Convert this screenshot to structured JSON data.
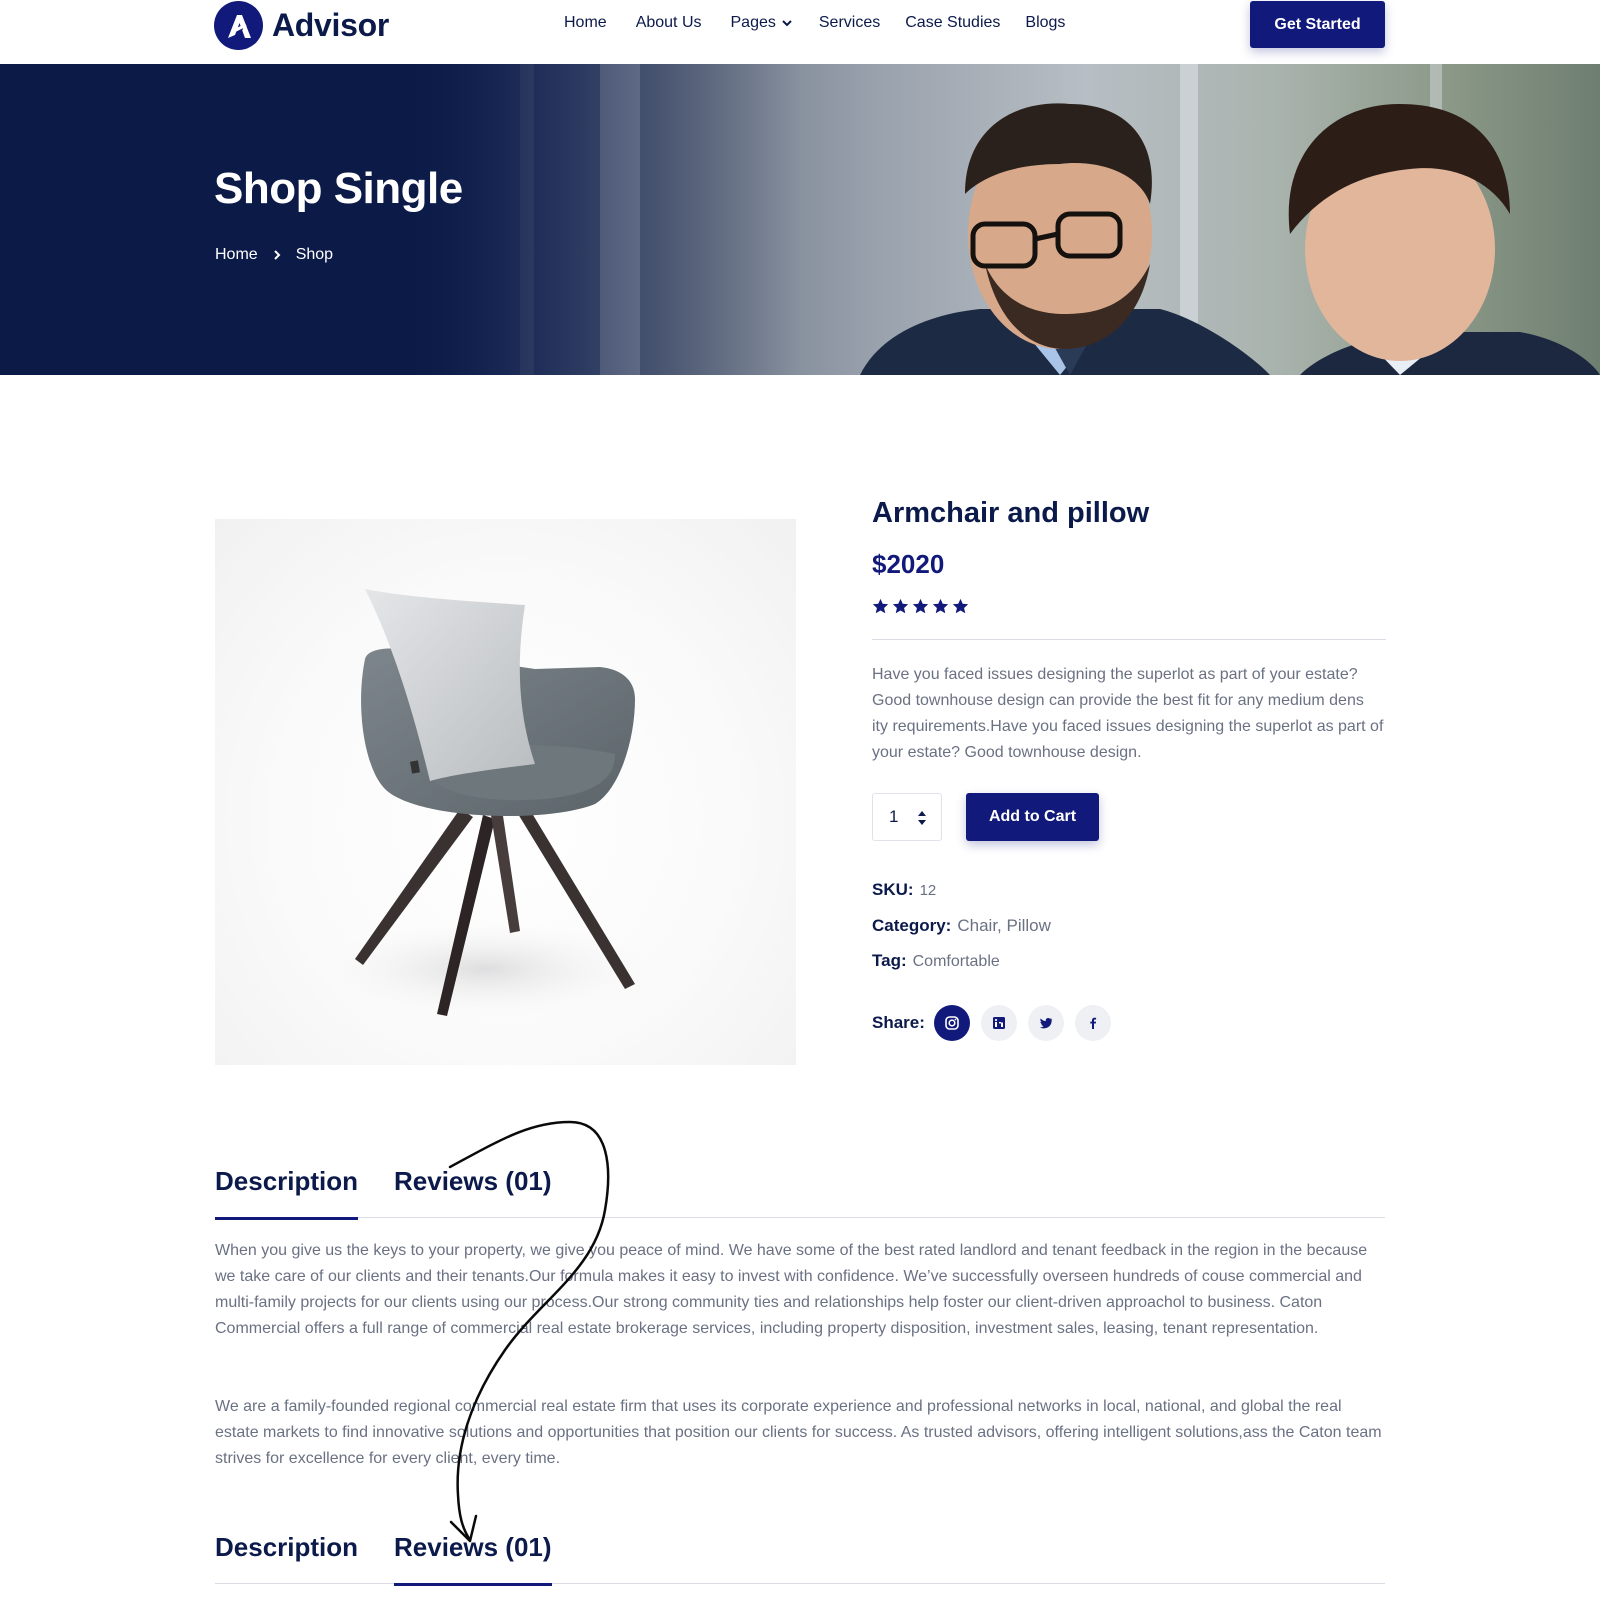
{
  "brand": {
    "name": "Advisor",
    "color": "#11197a",
    "dark": "#0b1a4a"
  },
  "nav": {
    "items": [
      {
        "label": "Home"
      },
      {
        "label": "About Us"
      },
      {
        "label": "Pages",
        "has_dropdown": true
      },
      {
        "label": "Services"
      },
      {
        "label": "Case Studies"
      },
      {
        "label": "Blogs"
      }
    ],
    "cta": "Get Started"
  },
  "hero": {
    "title": "Shop Single",
    "breadcrumb": [
      "Home",
      "Shop"
    ]
  },
  "product": {
    "name": "Armchair and pillow",
    "price": "$2020",
    "rating": 5,
    "rating_max": 5,
    "description": "Have you faced issues designing the superlot as part of your estate? Good townhouse design can provide the best fit for any medium dens ity requirements.Have you faced issues designing the superlot as part of your estate? Good townhouse design.",
    "quantity": "1",
    "add_to_cart": "Add to Cart",
    "sku_label": "SKU:",
    "sku": "12",
    "category_label": "Category:",
    "category": "Chair, Pillow",
    "tag_label": "Tag:",
    "tag": "Comfortable",
    "share_label": "Share:",
    "share_icons": [
      "instagram-icon",
      "linkedin-icon",
      "twitter-icon",
      "facebook-icon"
    ]
  },
  "tabs": {
    "description": "Description",
    "reviews": "Reviews (01)",
    "active_first": "description",
    "active_second": "reviews"
  },
  "description_text": {
    "p1": "When you give us the keys to your property, we give you peace of mind. We have some of the best rated landlord and tenant feedback in the region in the because we take care of our clients and their tenants.Our formula makes it easy to invest with confidence. We’ve successfully overseen hundreds of couse commercial and multi-family projects for our clients using our process.Our strong community ties and relationships help foster our client-driven approachol to business. Caton Commercial offers a full range of commercial real estate brokerage services, including property disposition, investment sales, leasing, tenant representation.",
    "p2": "We are a family-founded regional commercial real estate firm that uses its corporate experience and professional networks in local, national, and global the real estate markets to find innovative solutions and opportunities that position our clients for success. As trusted advisors, offering intelligent solutions,ass the Caton team strives for excellence for every client, every time."
  }
}
